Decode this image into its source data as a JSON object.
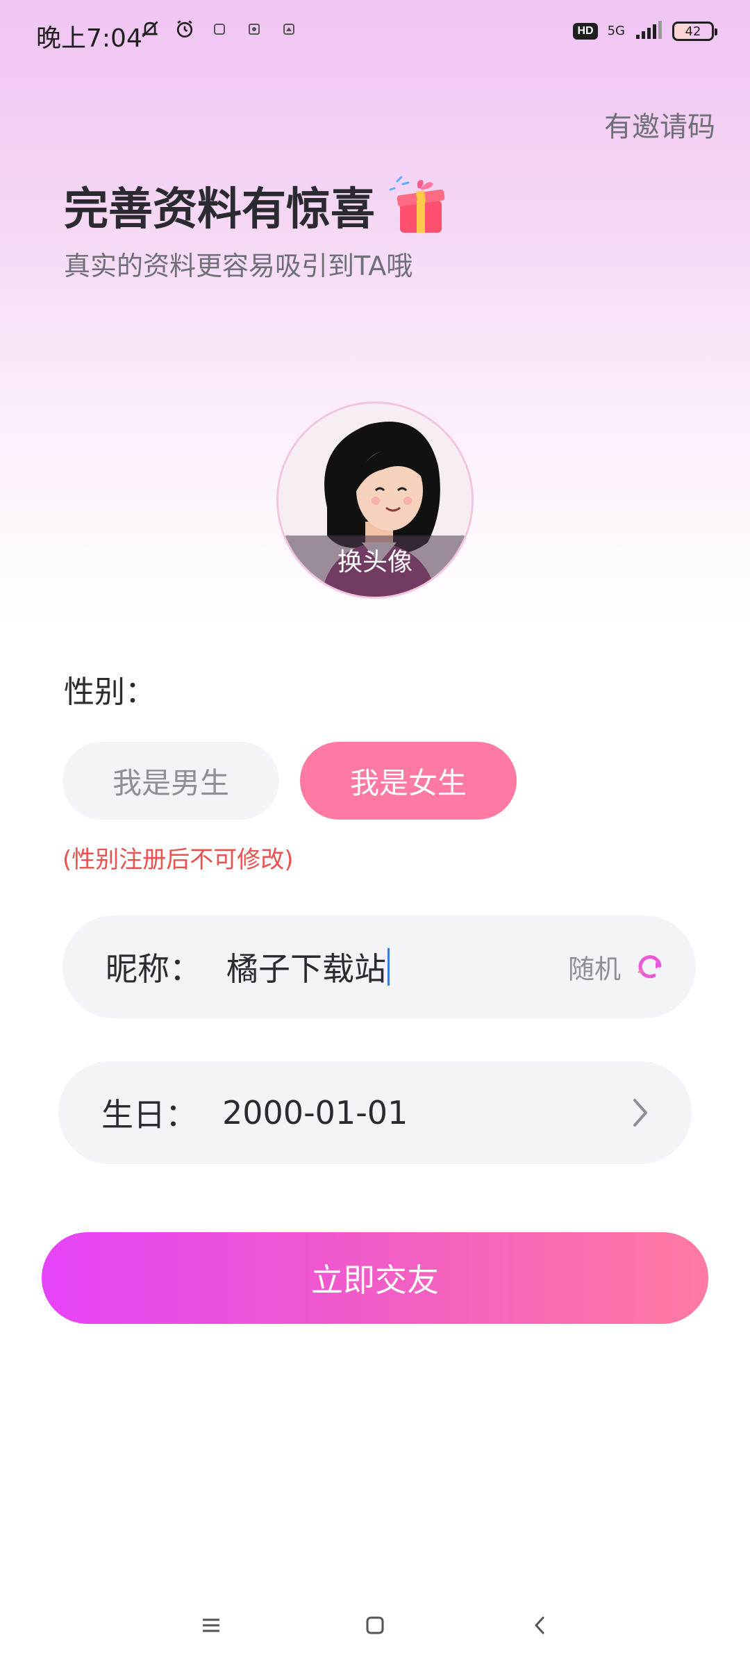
{
  "status_bar": {
    "time": "晚上7:04",
    "hd": "HD",
    "network": "5G",
    "battery": "42"
  },
  "header": {
    "invite_code": "有邀请码",
    "title": "完善资料有惊喜",
    "subtitle": "真实的资料更容易吸引到TA哦"
  },
  "avatar": {
    "change_label": "换头像"
  },
  "gender": {
    "label": "性别：",
    "male": "我是男生",
    "female": "我是女生",
    "selected": "female",
    "note": "(性别注册后不可修改)"
  },
  "nickname": {
    "label": "昵称：",
    "value": "橘子下载站",
    "random": "随机"
  },
  "birthday": {
    "label": "生日：",
    "value": "2000-01-01"
  },
  "submit": {
    "label": "立即交友"
  },
  "colors": {
    "accent_pink": "#ff7aa2",
    "accent_purple": "#e643f8",
    "warning_red": "#e8524f"
  }
}
